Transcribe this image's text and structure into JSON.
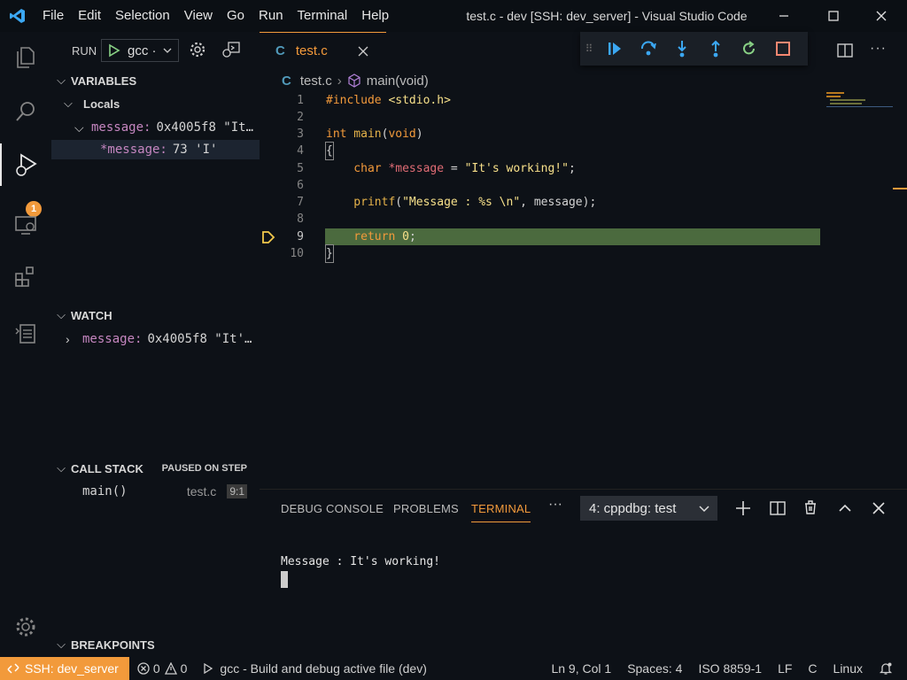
{
  "titlebar": {
    "menu": [
      "File",
      "Edit",
      "Selection",
      "View",
      "Go",
      "Run",
      "Terminal",
      "Help"
    ],
    "title": "test.c - dev [SSH: dev_server] - Visual Studio Code"
  },
  "activity": {
    "debug_badge": "1"
  },
  "run": {
    "label": "RUN",
    "config": "gcc ·"
  },
  "variables": {
    "header": "VARIABLES",
    "locals": "Locals",
    "rows": [
      {
        "name": "message:",
        "value": "0x4005f8 \"It…"
      },
      {
        "name": "*message:",
        "value": "73 'I'"
      }
    ]
  },
  "watch": {
    "header": "WATCH",
    "rows": [
      {
        "name": "message:",
        "value": "0x4005f8 \"It'…"
      }
    ]
  },
  "callstack": {
    "header": "CALL STACK",
    "status": "PAUSED ON STEP",
    "frame": "main()",
    "file": "test.c",
    "pos": "9:1"
  },
  "breakpoints": {
    "header": "BREAKPOINTS"
  },
  "editor": {
    "tab": "test.c",
    "tab_icon": "C",
    "breadcrumb_file": "test.c",
    "breadcrumb_symbol": "main(void)",
    "line_numbers": [
      "1",
      "2",
      "3",
      "4",
      "5",
      "6",
      "7",
      "8",
      "9",
      "10"
    ],
    "code": {
      "l1_kw": "#include",
      "l1_str": " <stdio.h>",
      "l3_type": "int",
      "l3_fn": " main",
      "l3_paren": "(",
      "l3_void": "void",
      "l3_close": ")",
      "l4": "{",
      "l5_type": "    char",
      "l5_var": " *message",
      "l5_eq": " = ",
      "l5_str": "\"It's working!\"",
      "l5_end": ";",
      "l7_fn": "    printf",
      "l7_paren": "(",
      "l7_str": "\"Message : %s \\n\"",
      "l7_rest": ", message);",
      "l9_kw": "    return",
      "l9_num": " 0",
      "l9_end": ";",
      "l10": "}"
    }
  },
  "panel": {
    "tabs": [
      "DEBUG CONSOLE",
      "PROBLEMS",
      "TERMINAL"
    ],
    "active_tab": "TERMINAL",
    "terminal_select": "4: cppdbg: test",
    "output": "Message : It's working!"
  },
  "status": {
    "remote": "SSH: dev_server",
    "errors": "0",
    "warnings": "0",
    "launch": "gcc - Build and debug active file (dev)",
    "position": "Ln 9, Col 1",
    "spaces": "Spaces: 4",
    "encoding": "ISO 8859-1",
    "eol": "LF",
    "language": "C",
    "os": "Linux"
  },
  "colors": {
    "accent": "#f29a3b",
    "highlight": "#4b6a3e",
    "background": "#0d1117"
  }
}
